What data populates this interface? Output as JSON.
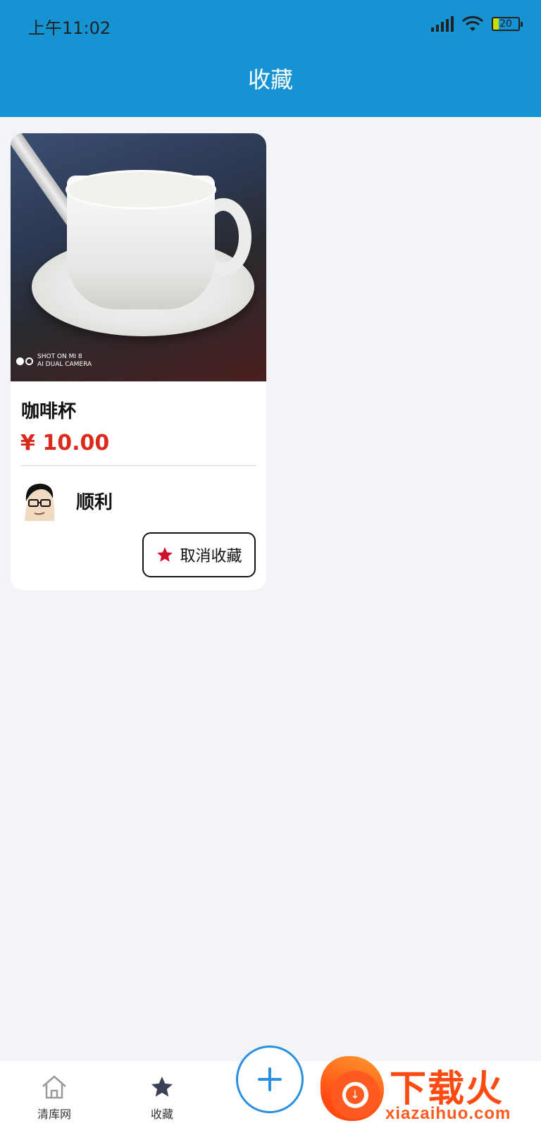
{
  "status_bar": {
    "time": "上午11:02",
    "battery": "20"
  },
  "header": {
    "title": "收藏"
  },
  "favorites": [
    {
      "photo_caption_line1": "SHOT ON MI 8",
      "photo_caption_line2": "AI DUAL CAMERA",
      "name": "咖啡杯",
      "price": "¥ 10.00",
      "seller": "顺利",
      "unfavorite_label": "取消收藏"
    }
  ],
  "tabbar": {
    "home_label": "清库网",
    "favorites_label": "收藏"
  },
  "brand": {
    "name": "下载火",
    "url": "xiazaihuo.com"
  },
  "colors": {
    "header": "#1593d3",
    "price": "#d92a1c",
    "star": "#d0102a",
    "fab_border": "#2a8fe0",
    "brand": "#ff4a12"
  }
}
